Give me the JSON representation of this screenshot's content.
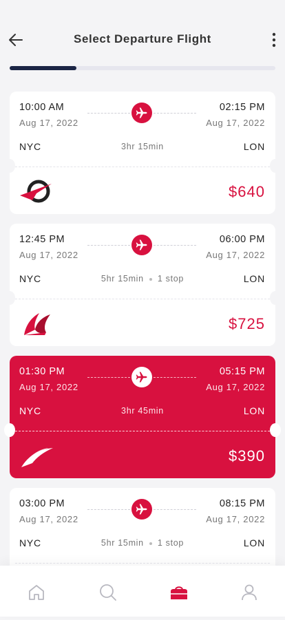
{
  "header": {
    "title": "Select Departure Flight",
    "back_icon": "arrow-left-icon",
    "menu_icon": "more-vertical-icon",
    "progress": 0.25
  },
  "flights": [
    {
      "depart_time": "10:00 AM",
      "depart_date": "Aug 17, 2022",
      "arrive_time": "02:15 PM",
      "arrive_date": "Aug 17, 2022",
      "from": "NYC",
      "to": "LON",
      "duration": "3hr 15min",
      "stops": "",
      "price": "$640",
      "airline_logo": "airline-logo-swoosh-ring",
      "selected": false
    },
    {
      "depart_time": "12:45 PM",
      "depart_date": "Aug 17, 2022",
      "arrive_time": "06:00 PM",
      "arrive_date": "Aug 17, 2022",
      "from": "NYC",
      "to": "LON",
      "duration": "5hr 15min",
      "stops": "1 stop",
      "price": "$725",
      "airline_logo": "airline-logo-wing",
      "selected": false
    },
    {
      "depart_time": "01:30 PM",
      "depart_date": "Aug 17, 2022",
      "arrive_time": "05:15 PM",
      "arrive_date": "Aug 17, 2022",
      "from": "NYC",
      "to": "LON",
      "duration": "3hr 45min",
      "stops": "",
      "price": "$390",
      "airline_logo": "airline-logo-swoosh",
      "selected": true
    },
    {
      "depart_time": "03:00 PM",
      "depart_date": "Aug 17, 2022",
      "arrive_time": "08:15 PM",
      "arrive_date": "Aug 17, 2022",
      "from": "NYC",
      "to": "LON",
      "duration": "5hr 15min",
      "stops": "1 stop",
      "price": "",
      "airline_logo": "",
      "selected": false
    }
  ],
  "tabbar": {
    "items": [
      {
        "icon": "home-icon",
        "active": false
      },
      {
        "icon": "search-icon",
        "active": false
      },
      {
        "icon": "bag-icon",
        "active": true
      },
      {
        "icon": "user-icon",
        "active": false
      }
    ]
  },
  "colors": {
    "accent": "#d8113f",
    "navy": "#1b2545",
    "background": "#f4f4f6",
    "inactive_icon": "#b8b8c0"
  }
}
